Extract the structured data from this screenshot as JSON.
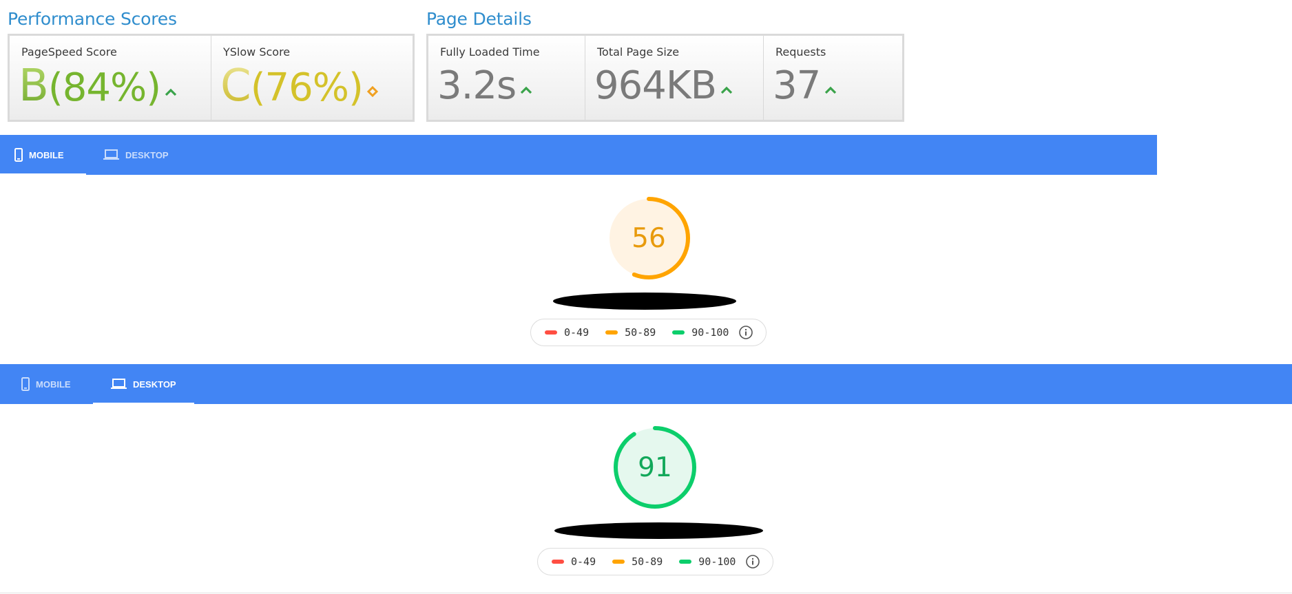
{
  "performance": {
    "title": "Performance Scores",
    "pagespeed": {
      "label": "PageSpeed Score",
      "grade": "B",
      "percent": "(84%)",
      "trend": "up-arrow-icon"
    },
    "yslow": {
      "label": "YSlow Score",
      "grade": "C",
      "percent": "(76%)",
      "trend": "diamond-icon"
    }
  },
  "details": {
    "title": "Page Details",
    "loaded": {
      "label": "Fully Loaded Time",
      "value": "3.2s",
      "trend": "up-arrow-icon"
    },
    "size": {
      "label": "Total Page Size",
      "value": "964KB",
      "trend": "up-arrow-icon"
    },
    "requests": {
      "label": "Requests",
      "value": "37",
      "trend": "up-arrow-icon"
    }
  },
  "mobile_panel": {
    "tabs": {
      "mobile": "MOBILE",
      "desktop": "DESKTOP",
      "active": "mobile"
    },
    "score": "56",
    "score_fraction": 0.56,
    "score_color": "#ffa400",
    "score_bg": "#fff3e3"
  },
  "desktop_panel": {
    "tabs": {
      "mobile": "MOBILE",
      "desktop": "DESKTOP",
      "active": "desktop"
    },
    "score": "91",
    "score_fraction": 0.91,
    "score_color": "#0cce6b",
    "score_bg": "#e5f8ee"
  },
  "legend": {
    "low": "0-49",
    "mid": "50-89",
    "high": "90-100",
    "low_color": "#ff4e42",
    "mid_color": "#ffa400",
    "high_color": "#0cce6b",
    "info_icon": "info-icon"
  },
  "colors": {
    "title_blue": "#2f8dcd",
    "grade_b": "#76b52f",
    "grade_c": "#d4c22a",
    "value_gray": "#7a7a7a",
    "tab_blue": "#4285f4",
    "trend_green": "#3aa34a",
    "trend_orange": "#f0a020"
  }
}
